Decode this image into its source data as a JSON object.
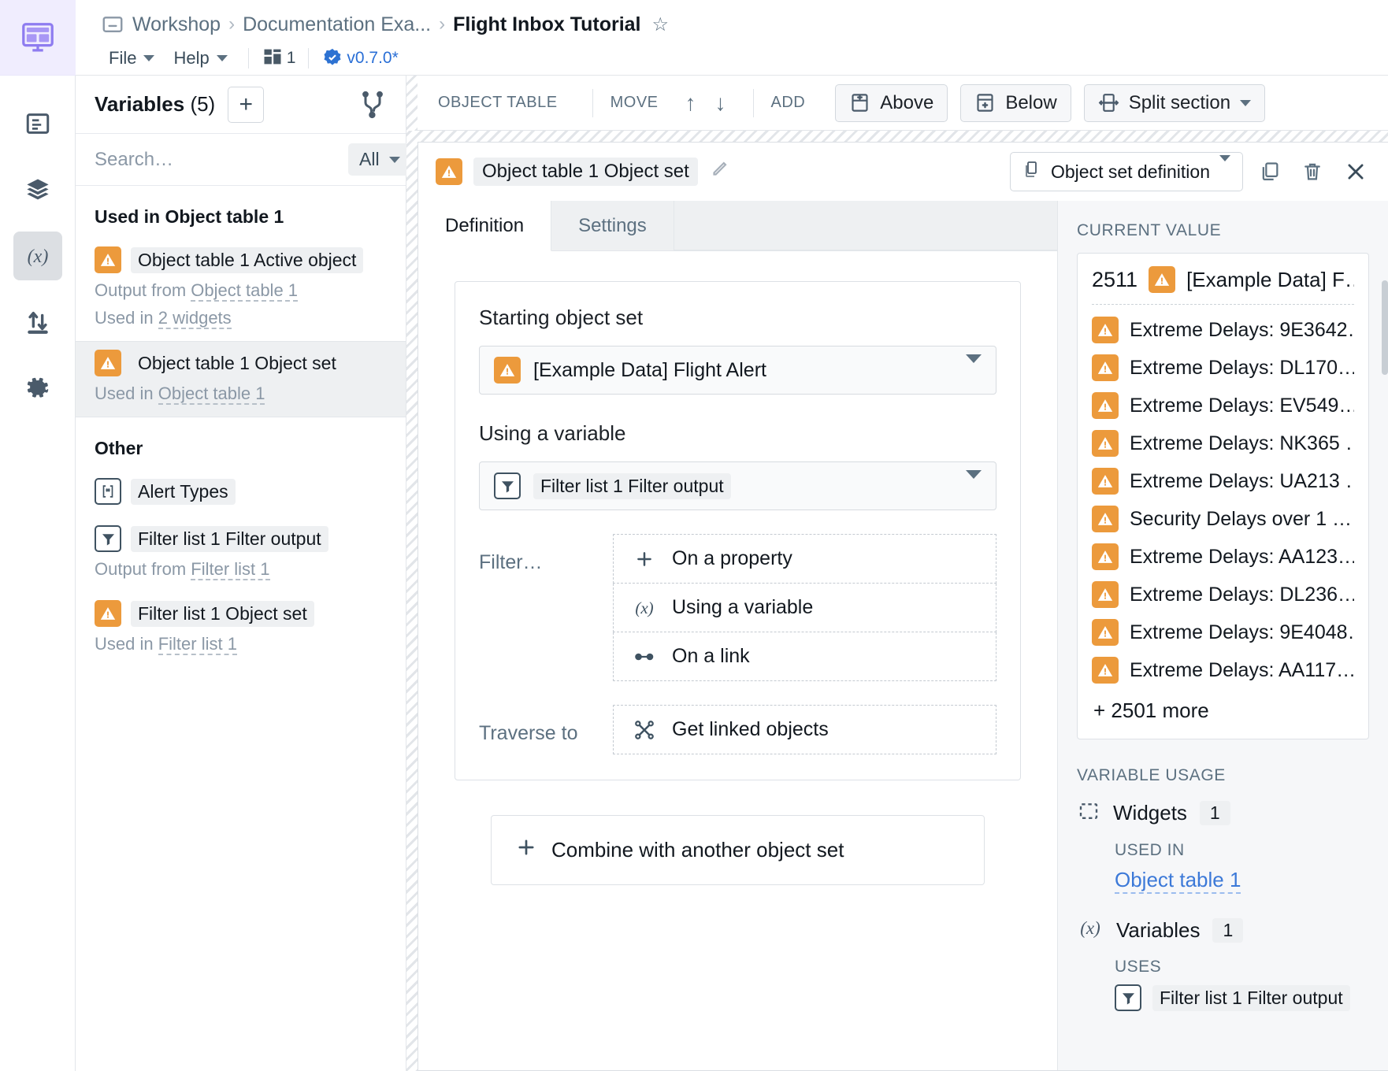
{
  "rail": {
    "logo_icon": "workshop-logo-icon",
    "items": [
      {
        "icon": "layout-pane-icon",
        "name": "widgets"
      },
      {
        "icon": "layers-icon",
        "name": "layers"
      },
      {
        "icon": "variable-fx-icon",
        "name": "variables",
        "active": true
      },
      {
        "icon": "data-transfer-icon",
        "name": "events"
      },
      {
        "icon": "gear-icon",
        "name": "settings"
      }
    ]
  },
  "header": {
    "breadcrumbs": [
      "Workshop",
      "Documentation Exa...",
      "Flight Inbox Tutorial"
    ],
    "separator": "›",
    "star_glyph": "☆",
    "menus": [
      "File",
      "Help"
    ],
    "widget_count": "1",
    "version": "v0.7.0*"
  },
  "sidebar": {
    "title": "Variables",
    "count": "(5)",
    "add_label": "+",
    "search_placeholder": "Search…",
    "filter_label": "All",
    "groups": [
      {
        "title": "Used in Object table 1",
        "items": [
          {
            "icon": "warning-object-icon",
            "label": "Object table 1 Active object",
            "meta": [
              {
                "prefix": "Output from",
                "link": "Object table 1"
              },
              {
                "prefix": "Used in",
                "link": "2 widgets"
              }
            ],
            "selected": false
          },
          {
            "icon": "warning-object-icon",
            "label": "Object table 1 Object set",
            "meta": [
              {
                "prefix": "Used in",
                "link": "Object table 1"
              }
            ],
            "selected": true
          }
        ]
      },
      {
        "title": "Other",
        "items": [
          {
            "icon": "string-type-icon",
            "label": "Alert Types",
            "meta": [],
            "selected": false
          },
          {
            "icon": "filter-icon",
            "label": "Filter list 1 Filter output",
            "meta": [
              {
                "prefix": "Output from",
                "link": "Filter list 1"
              }
            ],
            "selected": false
          },
          {
            "icon": "warning-object-icon",
            "label": "Filter list 1 Object set",
            "meta": [
              {
                "prefix": "Used in",
                "link": "Filter list 1"
              }
            ],
            "selected": false
          }
        ]
      }
    ]
  },
  "toolbar": {
    "context_label": "OBJECT TABLE",
    "move_label": "MOVE",
    "move_up_glyph": "↑",
    "move_down_glyph": "↓",
    "add_label": "ADD",
    "above_label": "Above",
    "below_label": "Below",
    "split_label": "Split section"
  },
  "panel": {
    "title_chip": "Object table 1 Object set",
    "edit_icon": "pencil-icon",
    "type_select": "Object set definition",
    "duplicate_icon": "duplicate-icon",
    "delete_icon": "trash-icon",
    "close_icon": "close-icon",
    "tabs": [
      {
        "label": "Definition",
        "active": true
      },
      {
        "label": "Settings",
        "active": false
      }
    ],
    "starting_object_set_label": "Starting object set",
    "starting_object_set_value": "[Example Data] Flight Alert",
    "using_variable_label": "Using a variable",
    "using_variable_value": "Filter list 1 Filter output",
    "filter_label": "Filter…",
    "filter_options": [
      {
        "icon": "plus-icon",
        "label": "On a property"
      },
      {
        "icon": "variable-fx-icon",
        "label": "Using a variable"
      },
      {
        "icon": "link-icon",
        "label": "On a link"
      }
    ],
    "traverse_label": "Traverse to",
    "traverse_options": [
      {
        "icon": "graph-nodes-icon",
        "label": "Get linked objects"
      }
    ],
    "combine_label": "Combine with another object set",
    "combine_icon": "plus-icon"
  },
  "value_panel": {
    "header": "CURRENT VALUE",
    "total": "2511",
    "total_label": "[Example Data] F…",
    "items": [
      "Extreme Delays: 9E3642…",
      "Extreme Delays: DL170…",
      "Extreme Delays: EV549…",
      "Extreme Delays: NK365 …",
      "Extreme Delays: UA213 …",
      "Security Delays over 1 …",
      "Extreme Delays: AA123…",
      "Extreme Delays: DL236…",
      "Extreme Delays: 9E4048…",
      "Extreme Delays: AA117…"
    ],
    "more_label": "+ 2501 more",
    "usage_header": "VARIABLE USAGE",
    "widgets_label": "Widgets",
    "widgets_count": "1",
    "used_in_label": "USED IN",
    "used_in_link": "Object table 1",
    "variables_label": "Variables",
    "variables_count": "1",
    "uses_label": "USES",
    "uses_chip": "Filter list 1 Filter output"
  },
  "colors": {
    "warning_orange": "#ec9a3c",
    "link_blue": "#3c79d8",
    "accent_purple": "#8e7cf0",
    "version_blue": "#2d72d2"
  }
}
